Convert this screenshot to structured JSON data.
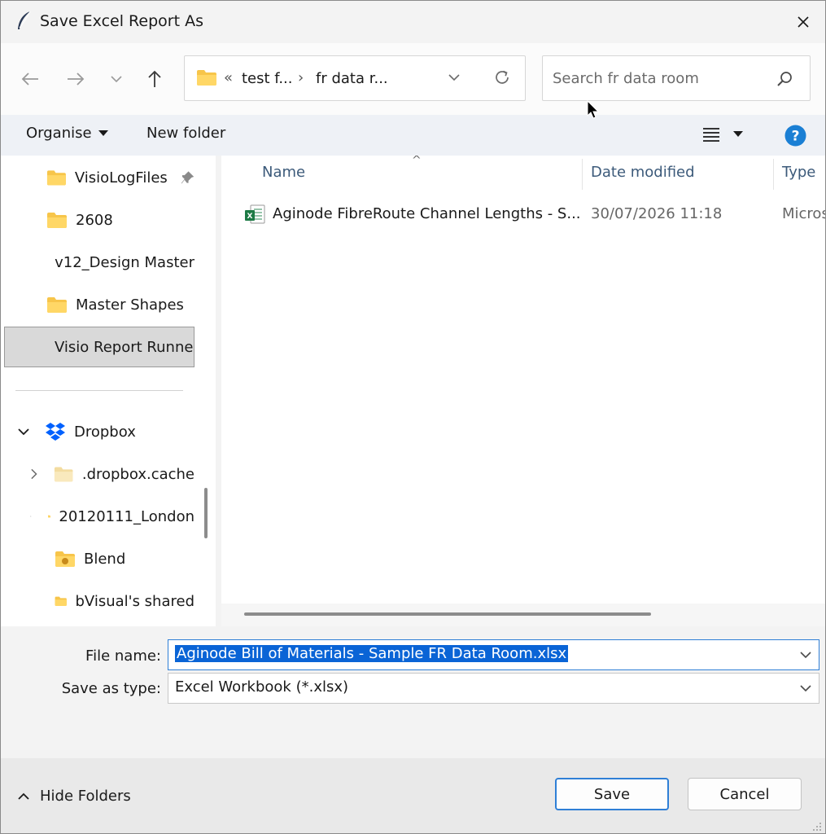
{
  "window": {
    "title": "Save Excel Report As",
    "title_icon": "feather-icon",
    "close_icon": "close-icon"
  },
  "nav": {
    "back_icon": "arrow-left-icon",
    "forward_icon": "arrow-right-icon",
    "recent_icon": "chevron-down-icon",
    "up_icon": "arrow-up-icon",
    "address": {
      "overflow": "«",
      "crumbs": [
        "test f...",
        "fr data r..."
      ],
      "separator": "›"
    },
    "refresh_icon": "refresh-icon",
    "search_placeholder": "Search fr data room"
  },
  "toolbar": {
    "organise": "Organise",
    "new_folder": "New folder",
    "view_icon": "list-view-icon",
    "help_icon": "help-icon"
  },
  "sidebar": {
    "items": [
      {
        "label": "VisioLogFiles",
        "icon": "folder-icon",
        "pinned": true
      },
      {
        "label": "2608",
        "icon": "folder-icon"
      },
      {
        "label": "v12_Design Master",
        "icon": "folder-icon"
      },
      {
        "label": "Master Shapes",
        "icon": "folder-icon"
      },
      {
        "label": "Visio Report Runner",
        "icon": "folder-icon",
        "selected": true
      }
    ],
    "dropbox": {
      "label": "Dropbox",
      "icon": "dropbox-icon",
      "expanded": true
    },
    "dropbox_items": [
      {
        "label": ".dropbox.cache",
        "icon": "folder-icon",
        "expandable": true
      },
      {
        "label": "20120111_London",
        "icon": "folder-icon",
        "expandable": true
      },
      {
        "label": "Blend",
        "icon": "folder-special-icon"
      },
      {
        "label": "bVisual's shared",
        "icon": "folder-icon"
      }
    ]
  },
  "files": {
    "columns": {
      "name": "Name",
      "date": "Date modified",
      "type": "Type"
    },
    "rows": [
      {
        "name": "Aginode FibreRoute Channel Lengths - S...",
        "date": "30/07/2026 11:18",
        "type": "Micros",
        "icon": "excel-file-icon"
      }
    ]
  },
  "form": {
    "file_name_label": "File name:",
    "file_name_value": "Aginode Bill of Materials - Sample FR Data Room.xlsx",
    "save_type_label": "Save as type:",
    "save_type_value": "Excel Workbook (*.xlsx)"
  },
  "footer": {
    "hide_folders": "Hide Folders",
    "save": "Save",
    "cancel": "Cancel"
  },
  "colors": {
    "accent": "#2f7fd6",
    "selection": "#0a64d6",
    "help": "#1a7fd4",
    "folder": "#f7c54a",
    "dropbox": "#0061fe"
  }
}
